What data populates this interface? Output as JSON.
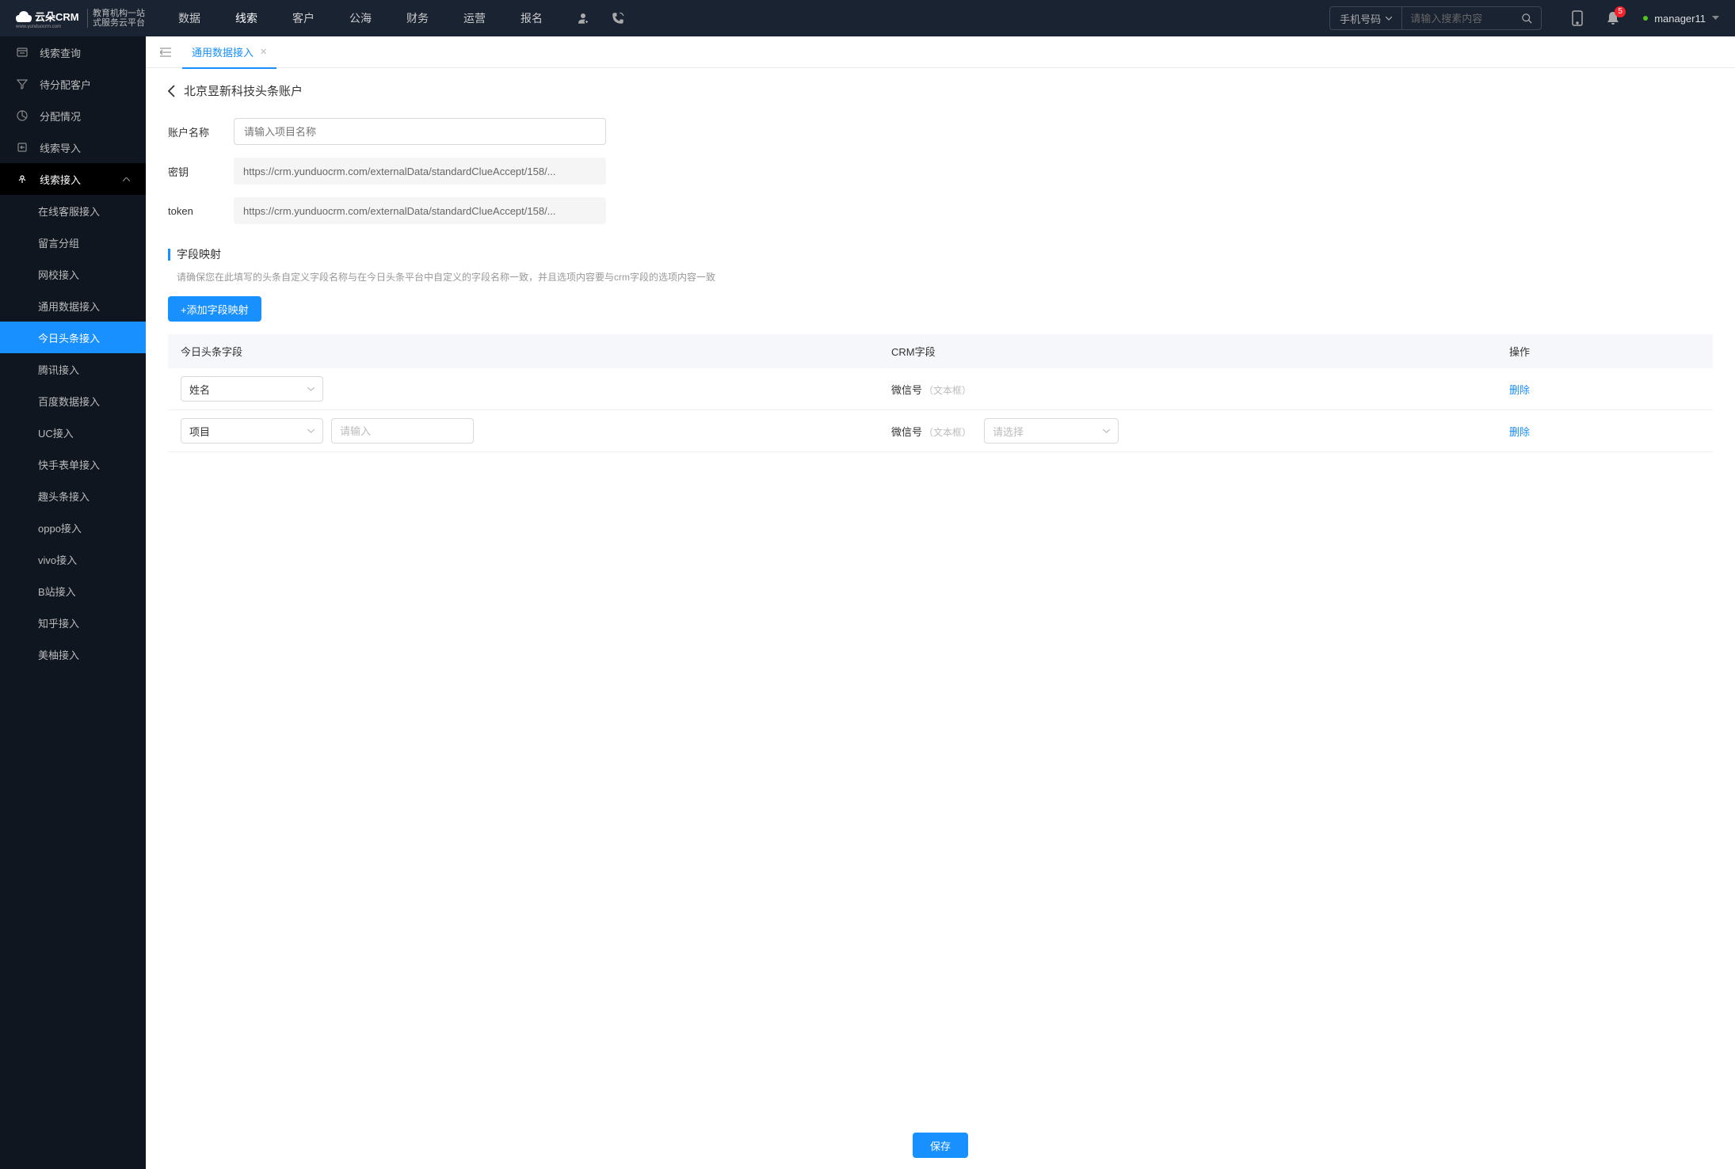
{
  "logo": {
    "name": "云朵CRM",
    "url": "www.yunduocrm.com",
    "sub1": "教育机构一站",
    "sub2": "式服务云平台"
  },
  "nav": {
    "items": [
      "数据",
      "线索",
      "客户",
      "公海",
      "财务",
      "运营",
      "报名"
    ],
    "active_index": 1
  },
  "search": {
    "type_label": "手机号码",
    "placeholder": "请输入搜素内容"
  },
  "notifications": {
    "badge": "5"
  },
  "user": {
    "name": "manager11"
  },
  "sidebar": {
    "items": [
      {
        "label": "线索查询",
        "icon": "clues"
      },
      {
        "label": "待分配客户",
        "icon": "filter"
      },
      {
        "label": "分配情况",
        "icon": "pie"
      },
      {
        "label": "线索导入",
        "icon": "import"
      },
      {
        "label": "线索接入",
        "icon": "plug",
        "expanded": true,
        "children": [
          "在线客服接入",
          "留言分组",
          "网校接入",
          "通用数据接入",
          "今日头条接入",
          "腾讯接入",
          "百度数据接入",
          "UC接入",
          "快手表单接入",
          "趣头条接入",
          "oppo接入",
          "vivo接入",
          "B站接入",
          "知乎接入",
          "美柚接入"
        ],
        "active_child_index": 4
      }
    ]
  },
  "tabs": {
    "items": [
      "通用数据接入"
    ],
    "active_index": 0
  },
  "page": {
    "title": "北京昱新科技头条账户",
    "form": {
      "account_label": "账户名称",
      "account_placeholder": "请输入项目名称",
      "secret_label": "密钥",
      "secret_value": "https://crm.yunduocrm.com/externalData/standardClueAccept/158/...",
      "token_label": "token",
      "token_value": "https://crm.yunduocrm.com/externalData/standardClueAccept/158/..."
    },
    "mapping": {
      "title": "字段映射",
      "desc": "请确保您在此填写的头条自定义字段名称与在今日头条平台中自定义的字段名称一致，并且选项内容要与crm字段的选项内容一致",
      "add_button": "+添加字段映射",
      "columns": {
        "source": "今日头条字段",
        "crm": "CRM字段",
        "action": "操作"
      },
      "rows": [
        {
          "source_select": "姓名",
          "crm_label": "微信号",
          "crm_type": "（文本框）",
          "delete": "删除"
        },
        {
          "source_select": "项目",
          "source_input_placeholder": "请输入",
          "crm_label": "微信号",
          "crm_type": "（文本框）",
          "crm_select_placeholder": "请选择",
          "delete": "删除"
        }
      ]
    },
    "save_button": "保存"
  }
}
